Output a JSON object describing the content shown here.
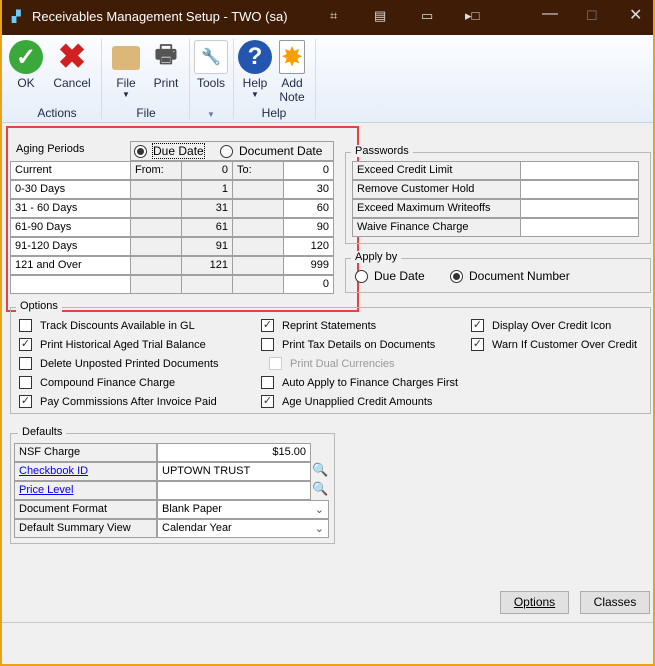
{
  "window": {
    "title": "Receivables Management Setup  -  TWO (sa)"
  },
  "ribbon": {
    "ok": "OK",
    "cancel": "Cancel",
    "file": "File",
    "print": "Print",
    "tools": "Tools",
    "help": "Help",
    "add_note": "Add Note",
    "groups": {
      "actions": "Actions",
      "file": "File",
      "help": "Help"
    }
  },
  "aging": {
    "label": "Aging Periods",
    "radio_due": "Due Date",
    "radio_doc": "Document Date",
    "selected": "Due Date",
    "from_label": "From:",
    "to_label": "To:",
    "rows": [
      {
        "name": "Current",
        "from": "0",
        "to": "0"
      },
      {
        "name": "0-30 Days",
        "from": "1",
        "to": "30"
      },
      {
        "name": "31 - 60 Days",
        "from": "31",
        "to": "60"
      },
      {
        "name": "61-90 Days",
        "from": "61",
        "to": "90"
      },
      {
        "name": "91-120 Days",
        "from": "91",
        "to": "120"
      },
      {
        "name": "121 and Over",
        "from": "121",
        "to": "999"
      },
      {
        "name": "",
        "from": "",
        "to": "0"
      }
    ]
  },
  "passwords": {
    "label": "Passwords",
    "rows": [
      {
        "name": "Exceed Credit Limit",
        "value": ""
      },
      {
        "name": "Remove Customer Hold",
        "value": ""
      },
      {
        "name": "Exceed Maximum Writeoffs",
        "value": ""
      },
      {
        "name": "Waive Finance Charge",
        "value": ""
      }
    ]
  },
  "apply_by": {
    "label": "Apply by",
    "due": "Due Date",
    "doc": "Document Number",
    "selected": "Document Number"
  },
  "options": {
    "label": "Options",
    "items": [
      {
        "label": "Track Discounts  Available in GL",
        "checked": false
      },
      {
        "label": "Print Historical  Aged Trial Balance",
        "checked": true
      },
      {
        "label": "Delete Unposted Printed Documents",
        "checked": false
      },
      {
        "label": "Compound Finance Charge",
        "checked": false
      },
      {
        "label": "Pay Commissions After Invoice Paid",
        "checked": true
      },
      {
        "label": "Reprint Statements",
        "checked": true
      },
      {
        "label": "Print Tax Details on Documents",
        "checked": false
      },
      {
        "label": "Print Dual Currencies",
        "checked": false,
        "disabled": true
      },
      {
        "label": "Auto Apply to Finance Charges First",
        "checked": false
      },
      {
        "label": "Age Unapplied Credit Amounts",
        "checked": true
      },
      {
        "label": "Display Over Credit Icon",
        "checked": true
      },
      {
        "label": "Warn If Customer Over Credit",
        "checked": true
      }
    ]
  },
  "defaults": {
    "label": "Defaults",
    "nsf_label": "NSF Charge",
    "nsf_value": "$15.00",
    "checkbook_label": "Checkbook ID",
    "checkbook_value": "UPTOWN TRUST",
    "price_label": "Price Level",
    "price_value": "",
    "format_label": "Document Format",
    "format_value": "Blank Paper",
    "summary_label": "Default Summary View",
    "summary_value": "Calendar Year"
  },
  "buttons": {
    "options": "Options",
    "classes": "Classes"
  },
  "colors": {
    "titlebar": "#3e1c06",
    "highlight": "#e8413f",
    "link": "#0000ee"
  }
}
